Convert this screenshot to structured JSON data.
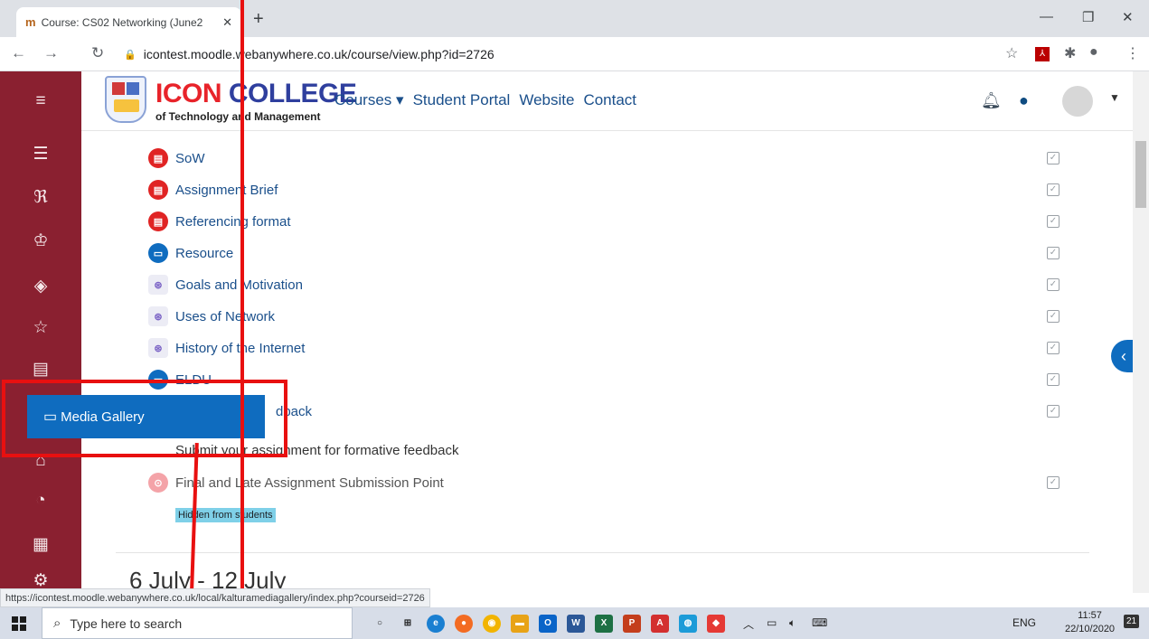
{
  "browser": {
    "tab_title": "Course: CS02 Networking (June2",
    "url": "icontest.moodle.webanywhere.co.uk/course/view.php?id=2726"
  },
  "header": {
    "brand_icon": "ICON",
    "brand_college": "COLLEGE",
    "brand_sub": "of Technology and Management",
    "nav": {
      "courses": "Courses",
      "student_portal": "Student Portal",
      "website": "Website",
      "contact": "Contact"
    }
  },
  "drawer_icons": [
    "menu-icon",
    "list-icon",
    "participants-icon",
    "badges-icon",
    "competencies-icon",
    "grades-icon",
    "book-icon",
    "home-icon",
    "dashboard-icon",
    "calendar-icon",
    "accessibility-icon"
  ],
  "activities": [
    {
      "label": "SoW",
      "icon": "pdf-icon",
      "completed": true
    },
    {
      "label": "Assignment Brief",
      "icon": "pdf-icon",
      "completed": true
    },
    {
      "label": "Referencing format",
      "icon": "pdf-icon",
      "completed": true
    },
    {
      "label": "Resource",
      "icon": "folder-icon",
      "completed": true
    },
    {
      "label": "Goals and Motivation",
      "icon": "kaltura-video-icon",
      "completed": true
    },
    {
      "label": "Uses of Network",
      "icon": "kaltura-video-icon",
      "completed": true
    },
    {
      "label": "History of the Internet",
      "icon": "kaltura-video-icon",
      "completed": true
    },
    {
      "label": "ELDU",
      "icon": "folder-icon",
      "completed": true
    },
    {
      "label": "dback",
      "icon": "assignment-icon",
      "completed": true
    }
  ],
  "formative_text": "Submit your assignment for formative feedback",
  "final_assignment": "Final and Late Assignment Submission Point",
  "hidden_badge": "Hidden from students",
  "section_title": "6 July - 12 July",
  "media_gallery": "Media Gallery",
  "status_url": "https://icontest.moodle.webanywhere.co.uk/local/kalturamediagallery/index.php?courseid=2726",
  "taskbar": {
    "search_placeholder": "Type here to search",
    "lang": "ENG",
    "time": "11:57",
    "date": "22/10/2020",
    "notifications": "21"
  }
}
